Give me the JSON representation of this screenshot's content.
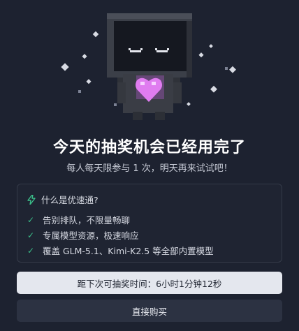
{
  "title": "今天的抽奖机会已经用完了",
  "subtitle": "每人每天限参与 1 次，明天再来试试吧！",
  "features_card": {
    "heading": "什么是优速通?",
    "items": [
      "告别排队，不限量畅聊",
      "专属模型资源，极速响应",
      "覆盖 GLM-5.1、Kimi-K2.5 等全部内置模型"
    ]
  },
  "countdown_button": "距下次可抽奖时间：6小时1分钟12秒",
  "buy_button": "直接购买",
  "colors": {
    "background": "#1d2230",
    "accent_green": "#3bbf8a",
    "heart_pink": "#e07cf0"
  }
}
